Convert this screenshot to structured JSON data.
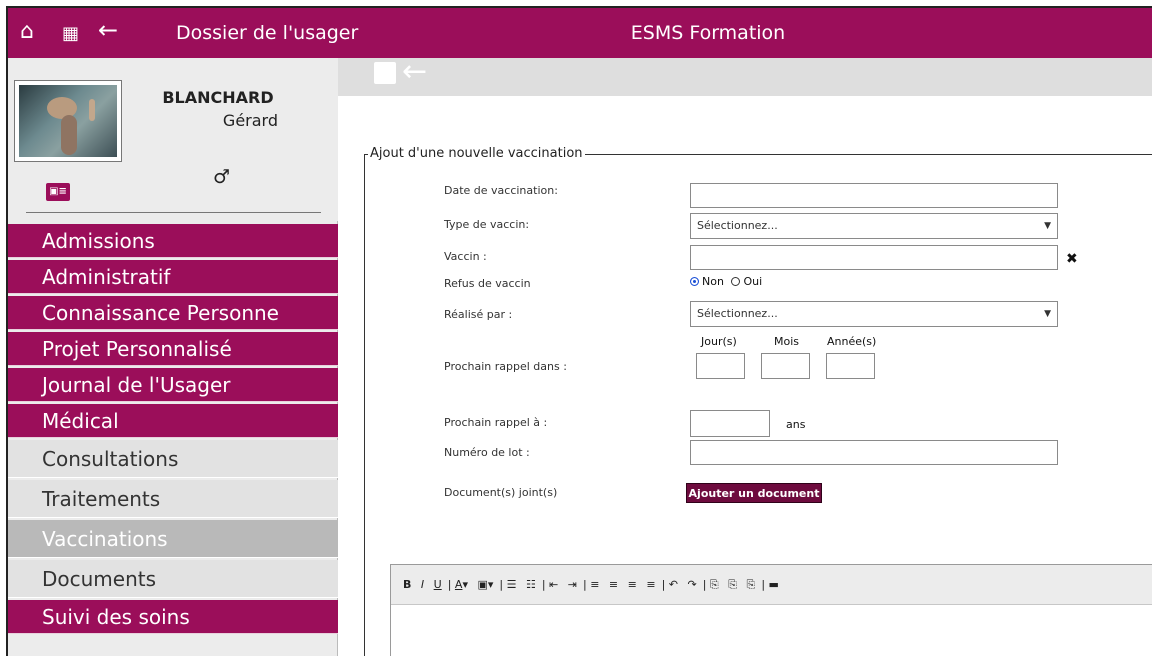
{
  "topbar": {
    "app_title": "Dossier de l'usager",
    "center_title": "ESMS Formation",
    "icons": [
      "home-icon",
      "apps-grid-icon",
      "back-arrow-icon"
    ]
  },
  "profile": {
    "last_name": "BLANCHARD",
    "first_name": "Gérard",
    "gender_symbol": "♂"
  },
  "menu": {
    "items": [
      {
        "label": "Admissions"
      },
      {
        "label": "Administratif"
      },
      {
        "label": "Connaissance Personne"
      },
      {
        "label": "Projet Personnalisé"
      },
      {
        "label": "Journal de l'Usager"
      },
      {
        "label": "Médical"
      }
    ],
    "sub_items": [
      {
        "label": "Consultations"
      },
      {
        "label": "Traitements"
      },
      {
        "label": "Vaccinations"
      },
      {
        "label": "Documents"
      }
    ],
    "last_item": {
      "label": "Suivi des soins"
    }
  },
  "form": {
    "legend": "Ajout d'une nouvelle vaccination",
    "labels": {
      "date": "Date de vaccination:",
      "type": "Type de vaccin:",
      "vaccine": "Vaccin :",
      "refusal": "Refus de vaccin",
      "performed_by": "Réalisé par :",
      "next_in": "Prochain rappel dans :",
      "next_at": "Prochain rappel à :",
      "lot": "Numéro de lot :",
      "documents": "Document(s) joint(s)"
    },
    "select_placeholder": "Sélectionnez...",
    "radio": {
      "non": "Non",
      "oui": "Oui",
      "selected": "Non"
    },
    "reminder_cols": {
      "days": "Jour(s)",
      "months": "Mois",
      "years": "Année(s)"
    },
    "unit": "ans",
    "add_document_button": "Ajouter un document"
  },
  "colors": {
    "brand": "#9b0e5a",
    "brand_dark": "#6e0b3e"
  }
}
